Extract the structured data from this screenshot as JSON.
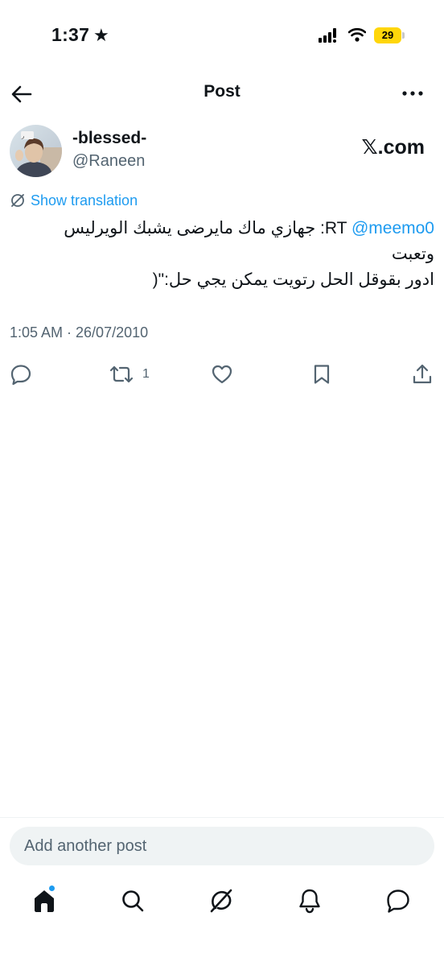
{
  "status_bar": {
    "time": "1:37",
    "battery_level": "29"
  },
  "header": {
    "title": "Post"
  },
  "author": {
    "display_name": "-blessed-",
    "handle": "@Raneen",
    "source": "𝕏.com"
  },
  "translation": {
    "label": "Show translation"
  },
  "post": {
    "line1_prefix": "RT ",
    "mention": "@meemo0",
    "line1_suffix": ": جهازي ماك مايرضى يشبك الويرليس",
    "line2": "وتعبت",
    "line3": "ادور بقوقل الحل رتويت يمكن يجي حل:\"(",
    "timestamp": "1:05 AM · 26/07/2010"
  },
  "actions": {
    "retweet_count": "1"
  },
  "reply_box": {
    "placeholder": "Add another post"
  },
  "colors": {
    "accent": "#1d9bf0",
    "text": "#0f1419",
    "secondary": "#536471",
    "battery": "#ffd60a"
  },
  "icons": [
    "back-arrow-icon",
    "more-icon",
    "translate-icon",
    "reply-icon",
    "retweet-icon",
    "like-icon",
    "bookmark-icon",
    "share-icon",
    "home-icon",
    "search-icon",
    "grok-icon",
    "notifications-icon",
    "messages-icon"
  ]
}
